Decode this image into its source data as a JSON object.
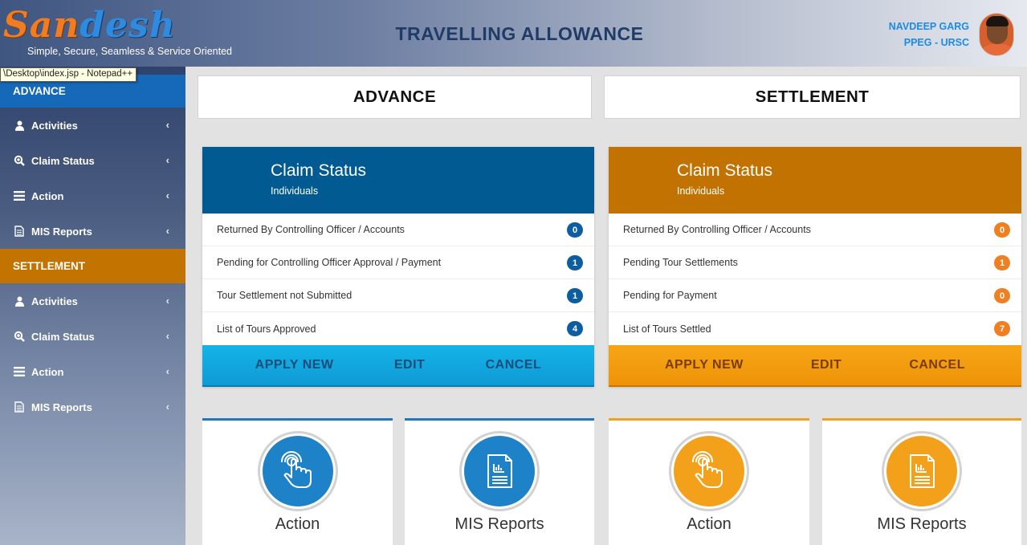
{
  "header": {
    "logo_part1": "San",
    "logo_part2": "desh",
    "tagline": "Simple, Secure, Seamless & Service Oriented",
    "title": "TRAVELLING ALLOWANCE",
    "user_name": "NAVDEEP GARG",
    "user_role": "PPEG - URSC"
  },
  "tooltip": "\\Desktop\\index.jsp - Notepad++",
  "sidebar": {
    "advance_label": "ADVANCE",
    "advance_items": [
      {
        "label": "Activities",
        "icon": "user-icon"
      },
      {
        "label": "Claim Status",
        "icon": "zoom-search-icon"
      },
      {
        "label": "Action",
        "icon": "list-icon"
      },
      {
        "label": "MIS Reports",
        "icon": "document-icon"
      }
    ],
    "settlement_label": "SETTLEMENT",
    "settlement_items": [
      {
        "label": "Activities",
        "icon": "user-icon"
      },
      {
        "label": "Claim Status",
        "icon": "zoom-search-icon"
      },
      {
        "label": "Action",
        "icon": "list-icon"
      },
      {
        "label": "MIS Reports",
        "icon": "document-icon"
      }
    ],
    "chevron": "‹"
  },
  "advance": {
    "title": "ADVANCE",
    "status_title": "Claim Status",
    "status_sub": "Individuals",
    "rows": [
      {
        "label": "Returned By Controlling Officer / Accounts",
        "count": "0"
      },
      {
        "label": "Pending for Controlling Officer Approval / Payment",
        "count": "1"
      },
      {
        "label": "Tour Settlement not Submitted",
        "count": "1"
      },
      {
        "label": "List of Tours Approved",
        "count": "4"
      }
    ],
    "buttons": {
      "apply": "APPLY NEW",
      "edit": "EDIT",
      "cancel": "CANCEL"
    },
    "tiles": [
      {
        "label": "Action",
        "icon": "touch-hand-icon"
      },
      {
        "label": "MIS Reports",
        "icon": "report-icon"
      }
    ],
    "colors": {
      "head": "#015a92",
      "badge": "#0d5ea0",
      "bar": "#19a6dc",
      "bar_text": "#1a4e7a",
      "tile_circle": "#1d82c7"
    }
  },
  "settlement": {
    "title": "SETTLEMENT",
    "status_title": "Claim Status",
    "status_sub": "Individuals",
    "rows": [
      {
        "label": "Returned By Controlling Officer / Accounts",
        "count": "0"
      },
      {
        "label": "Pending Tour Settlements",
        "count": "1"
      },
      {
        "label": "Pending for Payment",
        "count": "0"
      },
      {
        "label": "List of Tours Settled",
        "count": "7"
      }
    ],
    "buttons": {
      "apply": "APPLY NEW",
      "edit": "EDIT",
      "cancel": "CANCEL"
    },
    "tiles": [
      {
        "label": "Action",
        "icon": "touch-hand-icon"
      },
      {
        "label": "MIS Reports",
        "icon": "report-icon"
      }
    ],
    "colors": {
      "head": "#c27200",
      "badge": "#f07f22",
      "bar": "#f49c0c",
      "bar_text": "#7a3d00",
      "tile_circle": "#f3a01a"
    }
  }
}
